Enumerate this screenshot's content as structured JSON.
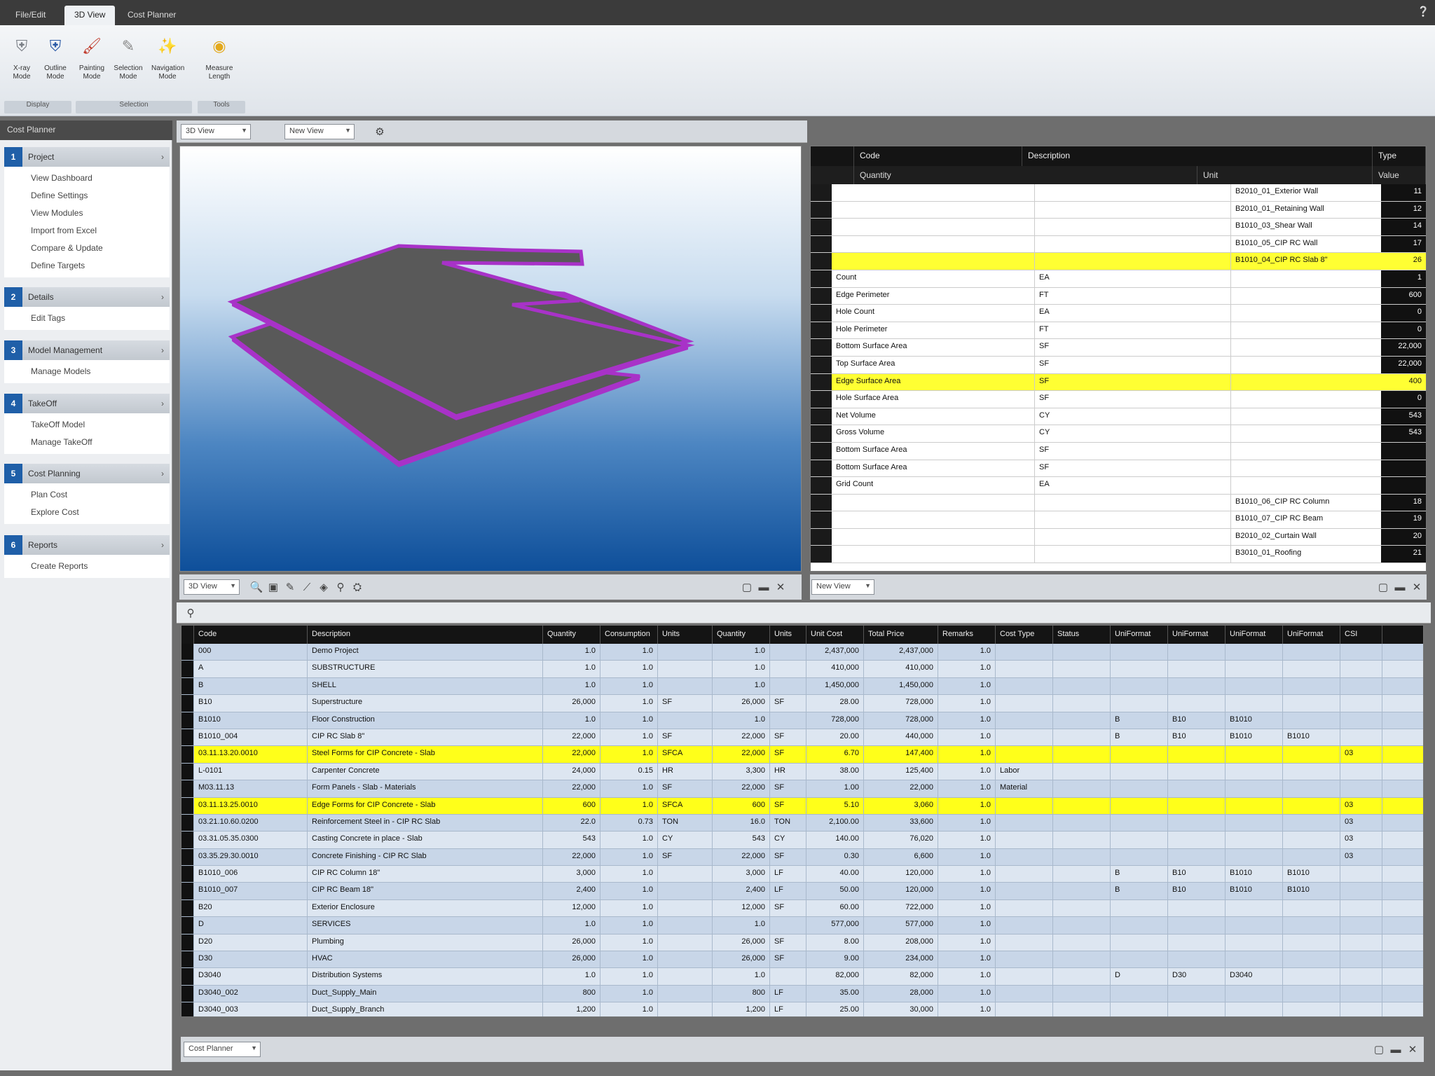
{
  "tabs": [
    "File/Edit",
    "3D View",
    "Cost Planner"
  ],
  "ribbon": {
    "buttons": [
      {
        "label": "X-ray Mode",
        "icon": "shield-gray-icon"
      },
      {
        "label": "Outline Mode",
        "icon": "shield-blue-icon"
      },
      {
        "label": "Painting Mode",
        "icon": "paintbrush-icon"
      },
      {
        "label": "Selection Mode",
        "icon": "pen-icon"
      },
      {
        "label": "Navigation Mode",
        "icon": "wand-icon"
      },
      {
        "label": "Measure Length",
        "icon": "tape-measure-icon"
      }
    ],
    "groups": [
      "Display",
      "Selection",
      "Tools"
    ]
  },
  "sidebar": {
    "title": "Cost Planner",
    "sections": [
      {
        "num": "1",
        "title": "Project",
        "items": [
          "View Dashboard",
          "Define Settings",
          "View Modules",
          "Import from Excel",
          "Compare & Update",
          "Define Targets"
        ]
      },
      {
        "num": "2",
        "title": "Details",
        "items": [
          "Edit Tags"
        ]
      },
      {
        "num": "3",
        "title": "Model Management",
        "items": [
          "Manage Models"
        ]
      },
      {
        "num": "4",
        "title": "TakeOff",
        "items": [
          "TakeOff Model",
          "Manage TakeOff"
        ]
      },
      {
        "num": "5",
        "title": "Cost Planning",
        "items": [
          "Plan Cost",
          "Explore Cost"
        ]
      },
      {
        "num": "6",
        "title": "Reports",
        "items": [
          "Create Reports"
        ]
      }
    ]
  },
  "view": {
    "mode_combo": "3D View",
    "toolbar_combo": "New View",
    "bottom_combo": "New View"
  },
  "props": {
    "headers": [
      "Code",
      "Description",
      "Type"
    ],
    "subheaders": [
      "Quantity",
      "Unit",
      "Value"
    ],
    "rows": [
      {
        "c1": "",
        "c2": "",
        "c3": "B2010_01_Exterior Wall",
        "v": "11",
        "hl": false
      },
      {
        "c1": "",
        "c2": "",
        "c3": "B2010_01_Retaining Wall",
        "v": "12",
        "hl": false
      },
      {
        "c1": "",
        "c2": "",
        "c3": "B1010_03_Shear Wall",
        "v": "14",
        "hl": false
      },
      {
        "c1": "",
        "c2": "",
        "c3": "B1010_05_CIP RC Wall",
        "v": "17",
        "hl": false
      },
      {
        "c1": "",
        "c2": "",
        "c3": "B1010_04_CIP RC Slab 8\"",
        "v": "26",
        "hl": true
      },
      {
        "c1": "Count",
        "c2": "EA",
        "c3": "",
        "v": "1",
        "hl": false
      },
      {
        "c1": "Edge Perimeter",
        "c2": "FT",
        "c3": "",
        "v": "600",
        "hl": false
      },
      {
        "c1": "Hole Count",
        "c2": "EA",
        "c3": "",
        "v": "0",
        "hl": false
      },
      {
        "c1": "Hole Perimeter",
        "c2": "FT",
        "c3": "",
        "v": "0",
        "hl": false
      },
      {
        "c1": "Bottom Surface Area",
        "c2": "SF",
        "c3": "",
        "v": "22,000",
        "hl": false
      },
      {
        "c1": "Top Surface Area",
        "c2": "SF",
        "c3": "",
        "v": "22,000",
        "hl": false
      },
      {
        "c1": "Edge Surface Area",
        "c2": "SF",
        "c3": "",
        "v": "400",
        "hl": true
      },
      {
        "c1": "Hole Surface Area",
        "c2": "SF",
        "c3": "",
        "v": "0",
        "hl": false
      },
      {
        "c1": "Net Volume",
        "c2": "CY",
        "c3": "",
        "v": "543",
        "hl": false
      },
      {
        "c1": "Gross Volume",
        "c2": "CY",
        "c3": "",
        "v": "543",
        "hl": false
      },
      {
        "c1": "Bottom Surface Area",
        "c2": "SF",
        "c3": "",
        "v": "",
        "hl": false
      },
      {
        "c1": "Bottom Surface Area",
        "c2": "SF",
        "c3": "",
        "v": "",
        "hl": false
      },
      {
        "c1": "Grid Count",
        "c2": "EA",
        "c3": "",
        "v": "",
        "hl": false
      },
      {
        "c1": "",
        "c2": "",
        "c3": "B1010_06_CIP RC Column",
        "v": "18",
        "hl": false
      },
      {
        "c1": "",
        "c2": "",
        "c3": "B1010_07_CIP RC Beam",
        "v": "19",
        "hl": false
      },
      {
        "c1": "",
        "c2": "",
        "c3": "B2010_02_Curtain Wall",
        "v": "20",
        "hl": false
      },
      {
        "c1": "",
        "c2": "",
        "c3": "B3010_01_Roofing",
        "v": "21",
        "hl": false
      }
    ]
  },
  "grid": {
    "headers": [
      "Code",
      "Description",
      "Quantity",
      "Consumption",
      "Units",
      "Quantity",
      "Units",
      "Unit Cost",
      "Total Price",
      "Remarks",
      "Cost Type",
      "Status",
      "UniFormat",
      "UniFormat",
      "UniFormat",
      "UniFormat",
      "CSI"
    ],
    "rows": [
      {
        "code": "000",
        "desc": "Demo Project",
        "q": "1.0",
        "cons": "1.0",
        "u": "",
        "q2": "1.0",
        "u2": "",
        "uc": "2,437,000",
        "tp": "2,437,000",
        "r": "1.0",
        "ct": "",
        "s": "",
        "f1": "",
        "f2": "",
        "f3": "",
        "f4": "",
        "csi": "",
        "hl": false
      },
      {
        "code": "A",
        "desc": "SUBSTRUCTURE",
        "q": "1.0",
        "cons": "1.0",
        "u": "",
        "q2": "1.0",
        "u2": "",
        "uc": "410,000",
        "tp": "410,000",
        "r": "1.0",
        "ct": "",
        "s": "",
        "f1": "",
        "f2": "",
        "f3": "",
        "f4": "",
        "csi": "",
        "hl": false
      },
      {
        "code": "B",
        "desc": "SHELL",
        "q": "1.0",
        "cons": "1.0",
        "u": "",
        "q2": "1.0",
        "u2": "",
        "uc": "1,450,000",
        "tp": "1,450,000",
        "r": "1.0",
        "ct": "",
        "s": "",
        "f1": "",
        "f2": "",
        "f3": "",
        "f4": "",
        "csi": "",
        "hl": false
      },
      {
        "code": "B10",
        "desc": "Superstructure",
        "q": "26,000",
        "cons": "1.0",
        "u": "SF",
        "q2": "26,000",
        "u2": "SF",
        "uc": "28.00",
        "tp": "728,000",
        "r": "1.0",
        "ct": "",
        "s": "",
        "f1": "",
        "f2": "",
        "f3": "",
        "f4": "",
        "csi": "",
        "hl": false
      },
      {
        "code": "B1010",
        "desc": "Floor Construction",
        "q": "1.0",
        "cons": "1.0",
        "u": "",
        "q2": "1.0",
        "u2": "",
        "uc": "728,000",
        "tp": "728,000",
        "r": "1.0",
        "ct": "",
        "s": "",
        "f1": "B",
        "f2": "B10",
        "f3": "B1010",
        "f4": "",
        "csi": "",
        "hl": false
      },
      {
        "code": "B1010_004",
        "desc": "CIP RC Slab 8\"",
        "q": "22,000",
        "cons": "1.0",
        "u": "SF",
        "q2": "22,000",
        "u2": "SF",
        "uc": "20.00",
        "tp": "440,000",
        "r": "1.0",
        "ct": "",
        "s": "",
        "f1": "B",
        "f2": "B10",
        "f3": "B1010",
        "f4": "B1010",
        "csi": "",
        "hl": false
      },
      {
        "code": "03.11.13.20.0010",
        "desc": "Steel Forms for CIP Concrete - Slab",
        "q": "22,000",
        "cons": "1.0",
        "u": "SFCA",
        "q2": "22,000",
        "u2": "SF",
        "uc": "6.70",
        "tp": "147,400",
        "r": "1.0",
        "ct": "",
        "s": "",
        "f1": "",
        "f2": "",
        "f3": "",
        "f4": "",
        "csi": "03",
        "hl": true
      },
      {
        "code": "L-0101",
        "desc": "Carpenter Concrete",
        "q": "24,000",
        "cons": "0.15",
        "u": "HR",
        "q2": "3,300",
        "u2": "HR",
        "uc": "38.00",
        "tp": "125,400",
        "r": "1.0",
        "ct": "Labor",
        "s": "",
        "f1": "",
        "f2": "",
        "f3": "",
        "f4": "",
        "csi": "",
        "hl": false
      },
      {
        "code": "M03.11.13",
        "desc": "Form Panels - Slab - Materials",
        "q": "22,000",
        "cons": "1.0",
        "u": "SF",
        "q2": "22,000",
        "u2": "SF",
        "uc": "1.00",
        "tp": "22,000",
        "r": "1.0",
        "ct": "Material",
        "s": "",
        "f1": "",
        "f2": "",
        "f3": "",
        "f4": "",
        "csi": "",
        "hl": false
      },
      {
        "code": "03.11.13.25.0010",
        "desc": "Edge Forms for CIP Concrete - Slab",
        "q": "600",
        "cons": "1.0",
        "u": "SFCA",
        "q2": "600",
        "u2": "SF",
        "uc": "5.10",
        "tp": "3,060",
        "r": "1.0",
        "ct": "",
        "s": "",
        "f1": "",
        "f2": "",
        "f3": "",
        "f4": "",
        "csi": "03",
        "hl": true
      },
      {
        "code": "03.21.10.60.0200",
        "desc": "Reinforcement Steel in - CIP RC Slab",
        "q": "22.0",
        "cons": "0.73",
        "u": "TON",
        "q2": "16.0",
        "u2": "TON",
        "uc": "2,100.00",
        "tp": "33,600",
        "r": "1.0",
        "ct": "",
        "s": "",
        "f1": "",
        "f2": "",
        "f3": "",
        "f4": "",
        "csi": "03",
        "hl": false
      },
      {
        "code": "03.31.05.35.0300",
        "desc": "Casting Concrete in place - Slab",
        "q": "543",
        "cons": "1.0",
        "u": "CY",
        "q2": "543",
        "u2": "CY",
        "uc": "140.00",
        "tp": "76,020",
        "r": "1.0",
        "ct": "",
        "s": "",
        "f1": "",
        "f2": "",
        "f3": "",
        "f4": "",
        "csi": "03",
        "hl": false
      },
      {
        "code": "03.35.29.30.0010",
        "desc": "Concrete Finishing - CIP RC Slab",
        "q": "22,000",
        "cons": "1.0",
        "u": "SF",
        "q2": "22,000",
        "u2": "SF",
        "uc": "0.30",
        "tp": "6,600",
        "r": "1.0",
        "ct": "",
        "s": "",
        "f1": "",
        "f2": "",
        "f3": "",
        "f4": "",
        "csi": "03",
        "hl": false
      },
      {
        "code": "B1010_006",
        "desc": "CIP RC Column 18\"",
        "q": "3,000",
        "cons": "1.0",
        "u": "",
        "q2": "3,000",
        "u2": "LF",
        "uc": "40.00",
        "tp": "120,000",
        "r": "1.0",
        "ct": "",
        "s": "",
        "f1": "B",
        "f2": "B10",
        "f3": "B1010",
        "f4": "B1010",
        "csi": "",
        "hl": false
      },
      {
        "code": "B1010_007",
        "desc": "CIP RC Beam 18\"",
        "q": "2,400",
        "cons": "1.0",
        "u": "",
        "q2": "2,400",
        "u2": "LF",
        "uc": "50.00",
        "tp": "120,000",
        "r": "1.0",
        "ct": "",
        "s": "",
        "f1": "B",
        "f2": "B10",
        "f3": "B1010",
        "f4": "B1010",
        "csi": "",
        "hl": false
      },
      {
        "code": "B20",
        "desc": "Exterior Enclosure",
        "q": "12,000",
        "cons": "1.0",
        "u": "",
        "q2": "12,000",
        "u2": "SF",
        "uc": "60.00",
        "tp": "722,000",
        "r": "1.0",
        "ct": "",
        "s": "",
        "f1": "",
        "f2": "",
        "f3": "",
        "f4": "",
        "csi": "",
        "hl": false
      },
      {
        "code": "D",
        "desc": "SERVICES",
        "q": "1.0",
        "cons": "1.0",
        "u": "",
        "q2": "1.0",
        "u2": "",
        "uc": "577,000",
        "tp": "577,000",
        "r": "1.0",
        "ct": "",
        "s": "",
        "f1": "",
        "f2": "",
        "f3": "",
        "f4": "",
        "csi": "",
        "hl": false
      },
      {
        "code": "D20",
        "desc": "Plumbing",
        "q": "26,000",
        "cons": "1.0",
        "u": "",
        "q2": "26,000",
        "u2": "SF",
        "uc": "8.00",
        "tp": "208,000",
        "r": "1.0",
        "ct": "",
        "s": "",
        "f1": "",
        "f2": "",
        "f3": "",
        "f4": "",
        "csi": "",
        "hl": false
      },
      {
        "code": "D30",
        "desc": "HVAC",
        "q": "26,000",
        "cons": "1.0",
        "u": "",
        "q2": "26,000",
        "u2": "SF",
        "uc": "9.00",
        "tp": "234,000",
        "r": "1.0",
        "ct": "",
        "s": "",
        "f1": "",
        "f2": "",
        "f3": "",
        "f4": "",
        "csi": "",
        "hl": false
      },
      {
        "code": "D3040",
        "desc": "Distribution Systems",
        "q": "1.0",
        "cons": "1.0",
        "u": "",
        "q2": "1.0",
        "u2": "",
        "uc": "82,000",
        "tp": "82,000",
        "r": "1.0",
        "ct": "",
        "s": "",
        "f1": "D",
        "f2": "D30",
        "f3": "D3040",
        "f4": "",
        "csi": "",
        "hl": false
      },
      {
        "code": "D3040_002",
        "desc": "Duct_Supply_Main",
        "q": "800",
        "cons": "1.0",
        "u": "",
        "q2": "800",
        "u2": "LF",
        "uc": "35.00",
        "tp": "28,000",
        "r": "1.0",
        "ct": "",
        "s": "",
        "f1": "",
        "f2": "",
        "f3": "",
        "f4": "",
        "csi": "",
        "hl": false
      },
      {
        "code": "D3040_003",
        "desc": "Duct_Supply_Branch",
        "q": "1,200",
        "cons": "1.0",
        "u": "",
        "q2": "1,200",
        "u2": "LF",
        "uc": "25.00",
        "tp": "30,000",
        "r": "1.0",
        "ct": "",
        "s": "",
        "f1": "",
        "f2": "",
        "f3": "",
        "f4": "",
        "csi": "",
        "hl": false
      }
    ],
    "bottom_combo": "Cost Planner"
  },
  "colors": {
    "highlight": "#ffff1a",
    "slab_fill": "#595959",
    "slab_edge": "#a832c8",
    "accent": "#1f5fa8"
  }
}
